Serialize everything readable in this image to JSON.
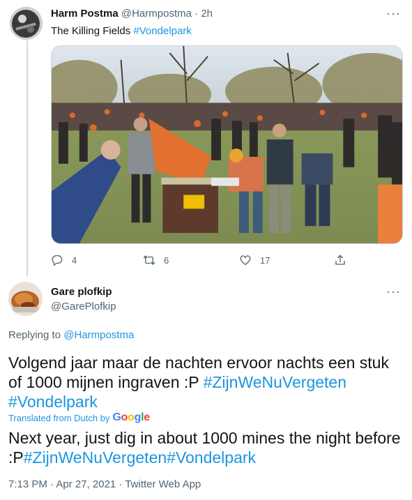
{
  "tweet1": {
    "name": "Harm Postma",
    "handle": "@Harmpostma",
    "separator": " · ",
    "time": "2h",
    "text_plain": "The Killing Fields ",
    "text_hashtag": "#Vondelpark",
    "more": "···",
    "stats": {
      "replies": "4",
      "retweets": "6",
      "likes": "17"
    },
    "media_icon": "crowd-photo"
  },
  "tweet2": {
    "name": "Gare plofkip",
    "handle": "@GarePlofkip",
    "more": "···",
    "replying_label": "Replying to ",
    "replying_handle": "@Harmpostma",
    "text_main": "Volgend jaar maar  de nachten ervoor nachts een stuk of 1000 mijnen ingraven :P ",
    "text_tag1": "#ZijnWeNuVergeten",
    "text_tag2": "#Vondelpark",
    "translated_label": "Translated from Dutch by",
    "google_logo": "Google",
    "translation_main": "Next year, just dig in about 1000 mines the night before :P",
    "translation_tag1": "#ZijnWeNuVergeten",
    "translation_tag2": "#Vondelpark",
    "meta": "7:13 PM · Apr 27, 2021 · Twitter Web App"
  },
  "colors": {
    "link": "#1b95e0",
    "muted": "#536471",
    "text": "#0f1419"
  }
}
